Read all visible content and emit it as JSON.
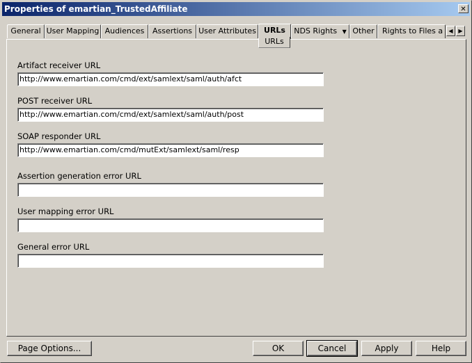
{
  "window": {
    "title": "Properties of emartian_TrustedAffiliate",
    "close_glyph": "✕"
  },
  "tabs": [
    {
      "label": "General"
    },
    {
      "label": "User Mapping"
    },
    {
      "label": "Audiences"
    },
    {
      "label": "Assertions"
    },
    {
      "label": "User Attributes"
    },
    {
      "label": "URLs",
      "active": true,
      "sub_label": "URLs"
    },
    {
      "label": "NDS Rights"
    },
    {
      "label": "Other"
    },
    {
      "label": "Rights to Files a"
    }
  ],
  "fields": [
    {
      "label": "Artifact receiver URL",
      "value": "http://www.emartian.com/cmd/ext/samlext/saml/auth/afct"
    },
    {
      "label": "POST receiver URL",
      "value": "http://www.emartian.com/cmd/ext/samlext/saml/auth/post"
    },
    {
      "label": "SOAP responder URL",
      "value": "http://www.emartian.com/cmd/mutExt/samlext/saml/resp"
    },
    {
      "label": "Assertion generation error URL",
      "value": ""
    },
    {
      "label": "User mapping error URL",
      "value": ""
    },
    {
      "label": "General error URL",
      "value": ""
    }
  ],
  "buttons": {
    "page_options": "Page Options...",
    "ok": "OK",
    "cancel": "Cancel",
    "apply": "Apply",
    "help": "Help"
  }
}
